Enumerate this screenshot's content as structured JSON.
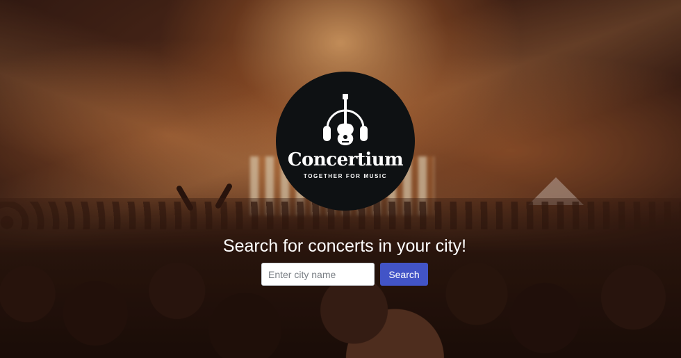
{
  "logo": {
    "name": "Concertium",
    "tagline": "TOGETHER FOR MUSIC",
    "icon": "guitar-headphones-icon",
    "background_color": "#0e1113"
  },
  "hero": {
    "headline": "Search for concerts in your city!"
  },
  "search": {
    "placeholder": "Enter city name",
    "value": "",
    "button_label": "Search",
    "button_color": "#4254c7"
  }
}
